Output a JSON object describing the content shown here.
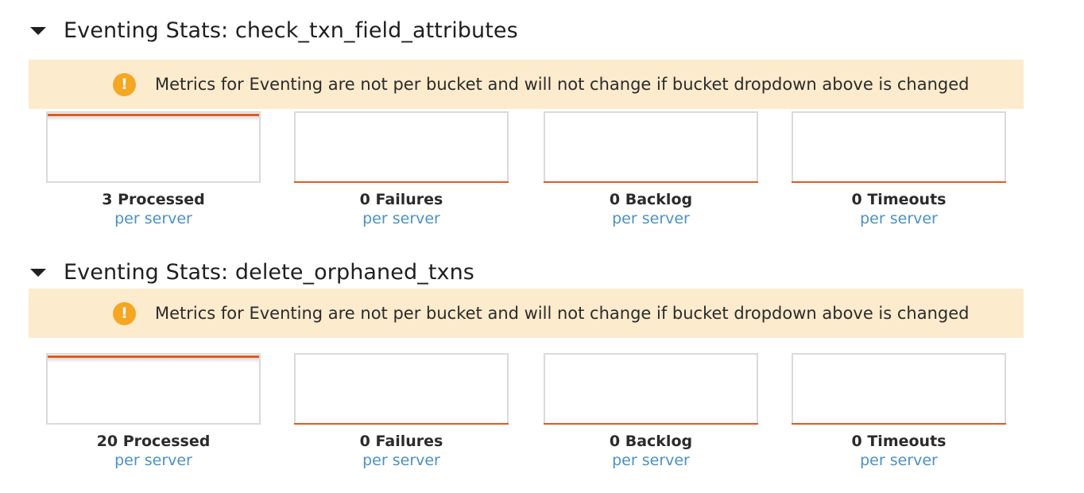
{
  "sections": [
    {
      "title": "Eventing Stats: check_txn_field_attributes",
      "notice": "Metrics for Eventing are not per bucket and will not change if bucket dropdown above is changed",
      "charts": [
        {
          "label": "3 Processed",
          "sub": "per server",
          "value": 3
        },
        {
          "label": "0 Failures",
          "sub": "per server",
          "value": 0
        },
        {
          "label": "0 Backlog",
          "sub": "per server",
          "value": 0
        },
        {
          "label": "0 Timeouts",
          "sub": "per server",
          "value": 0
        }
      ]
    },
    {
      "title": "Eventing Stats: delete_orphaned_txns",
      "notice": "Metrics for Eventing are not per bucket and will not change if bucket dropdown above is changed",
      "charts": [
        {
          "label": "20 Processed",
          "sub": "per server",
          "value": 20
        },
        {
          "label": "0 Failures",
          "sub": "per server",
          "value": 0
        },
        {
          "label": "0 Backlog",
          "sub": "per server",
          "value": 0
        },
        {
          "label": "0 Timeouts",
          "sub": "per server",
          "value": 0
        }
      ]
    }
  ],
  "icons": {
    "collapse": "caret-down-icon",
    "notice": "warning-icon",
    "notice_glyph": "!"
  },
  "colors": {
    "accent_line": "#e05a1e",
    "notice_bg": "#fcebcc",
    "warning_icon": "#f5a623",
    "link": "#4a90c8"
  }
}
